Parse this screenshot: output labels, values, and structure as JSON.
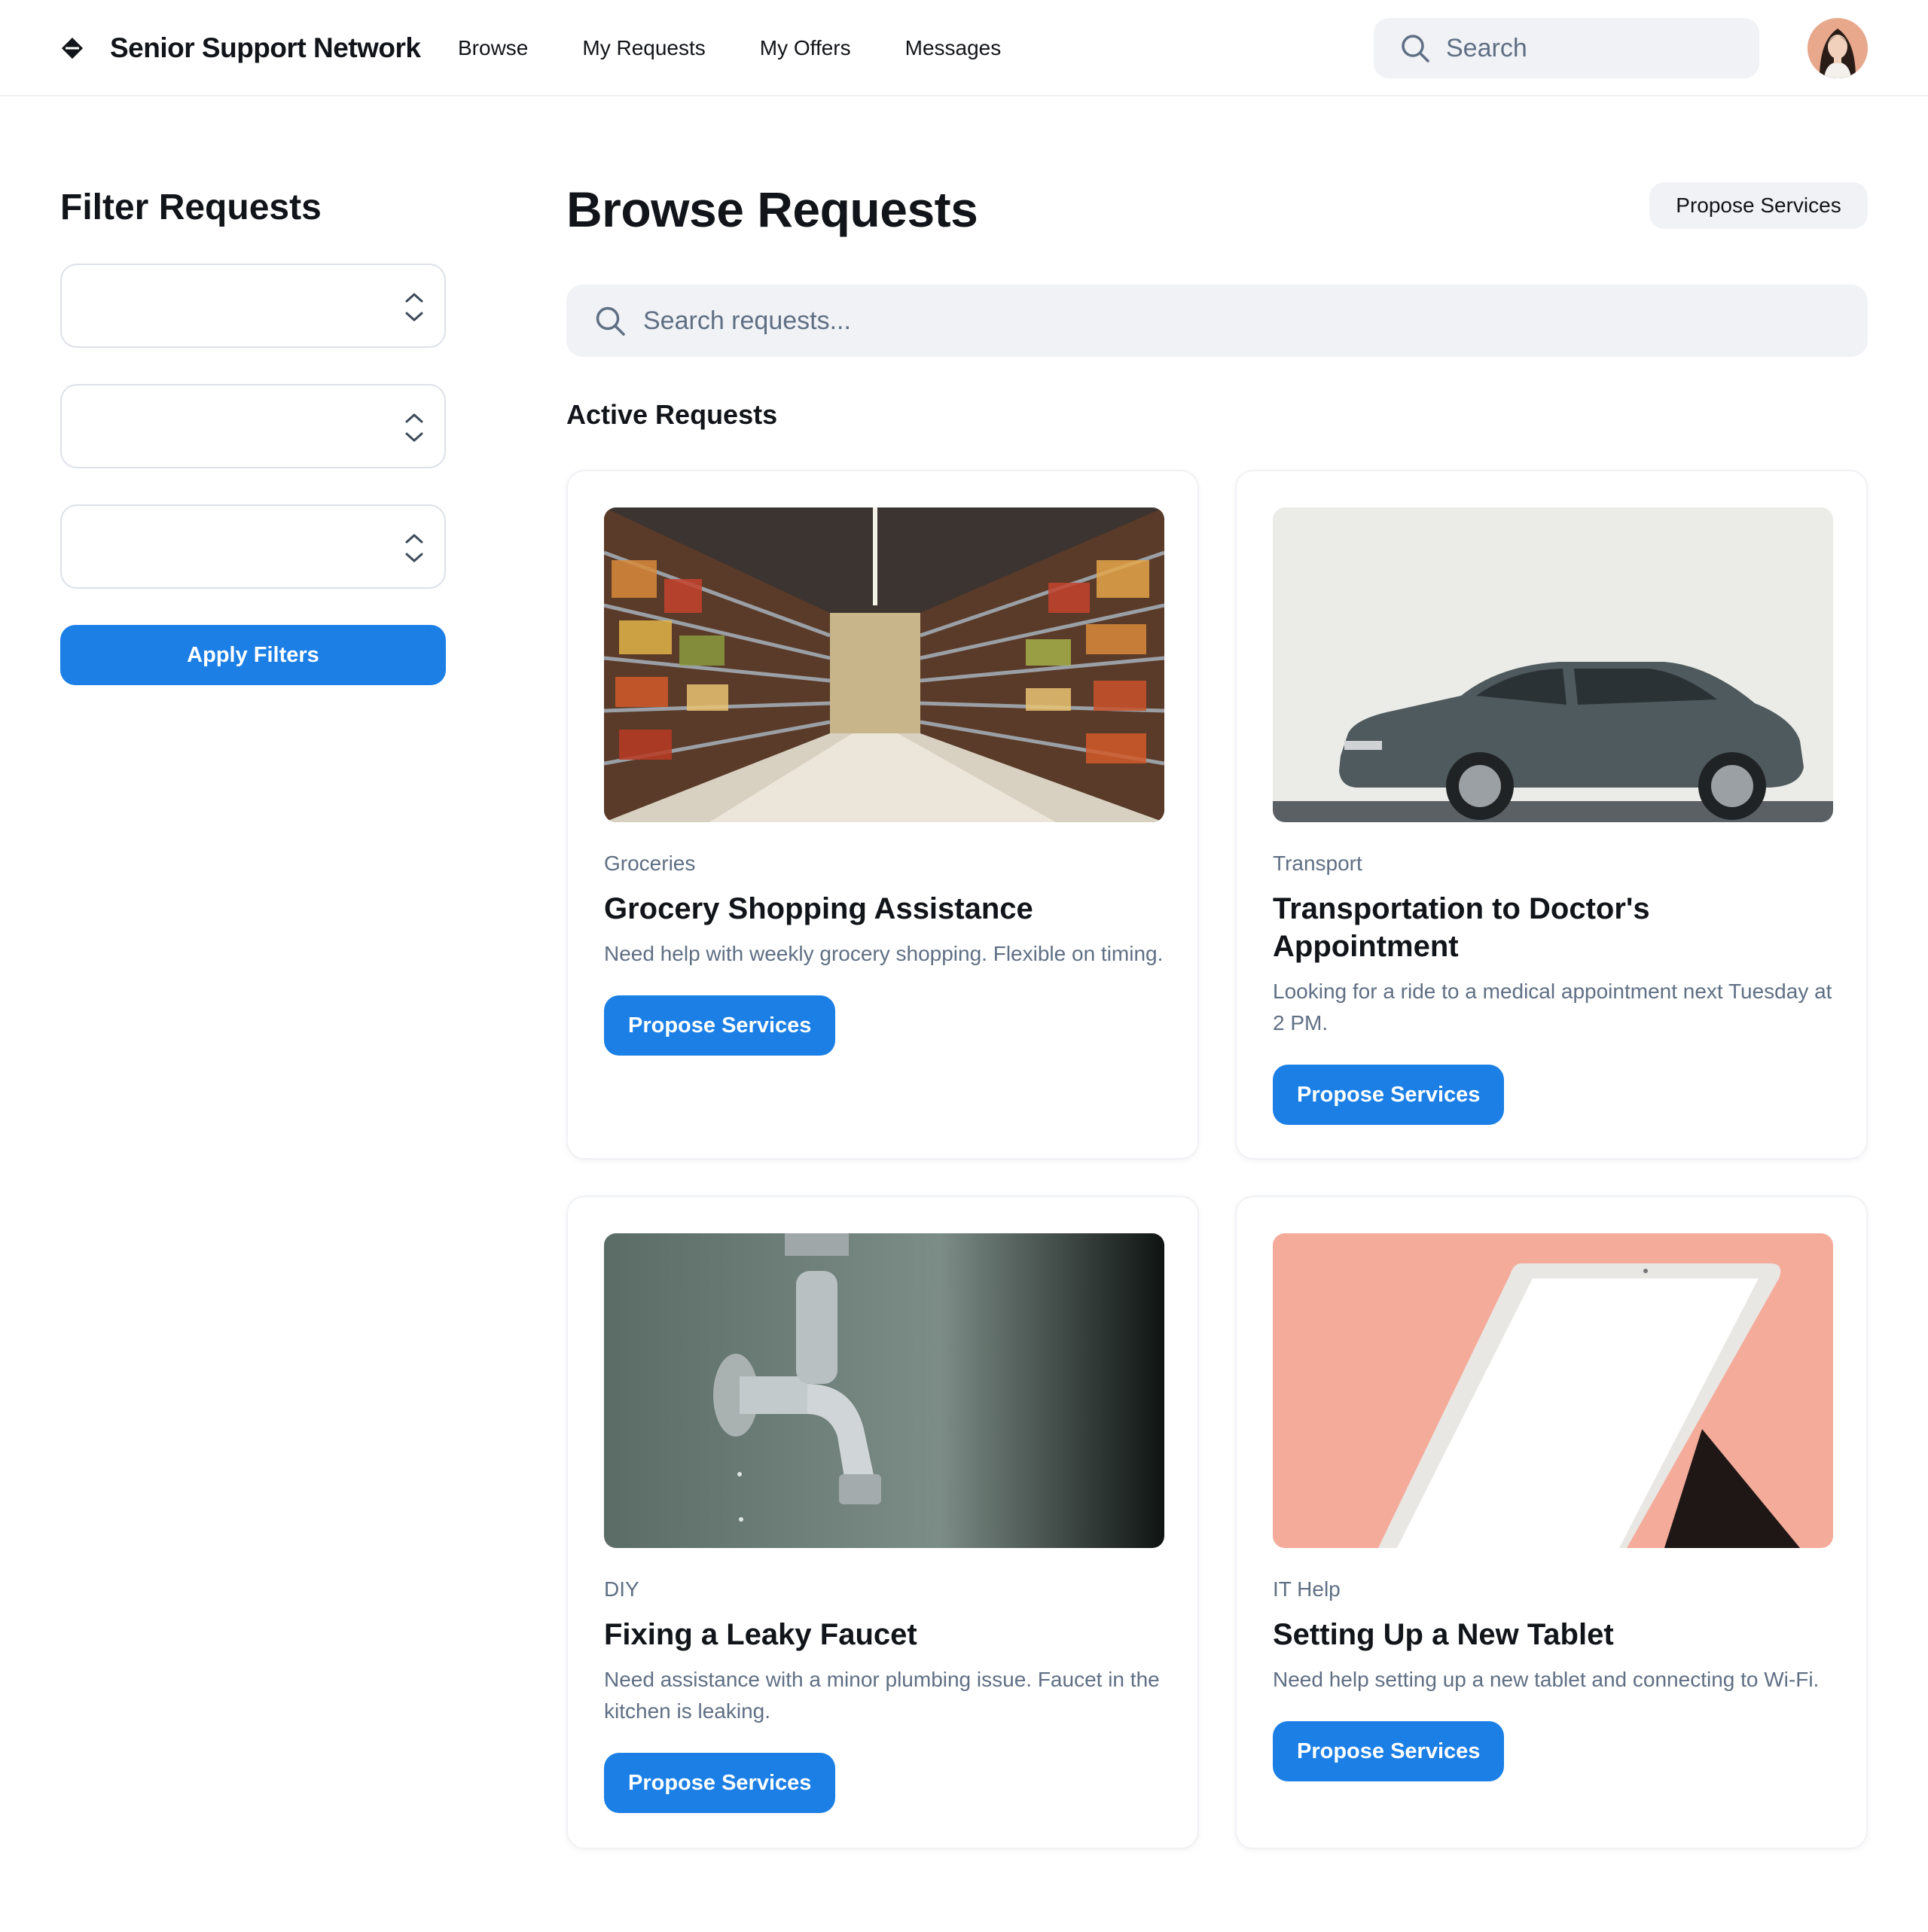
{
  "header": {
    "brand": "Senior Support Network",
    "nav": [
      "Browse",
      "My Requests",
      "My Offers",
      "Messages"
    ],
    "search_placeholder": "Search"
  },
  "sidebar": {
    "title": "Filter Requests",
    "filters": [
      "",
      "",
      ""
    ],
    "apply_label": "Apply Filters"
  },
  "main": {
    "title": "Browse Requests",
    "propose_label": "Propose Services",
    "search_placeholder": "Search requests...",
    "section_title": "Active Requests",
    "cards": [
      {
        "category": "Groceries",
        "title": "Grocery Shopping Assistance",
        "description": "Need help with weekly grocery shopping. Flexible on timing.",
        "button": "Propose Services"
      },
      {
        "category": "Transport",
        "title": "Transportation to Doctor's Appointment",
        "description": "Looking for a ride to a medical appointment next Tuesday at 2 PM.",
        "button": "Propose Services"
      },
      {
        "category": "DIY",
        "title": "Fixing a Leaky Faucet",
        "description": "Need assistance with a minor plumbing issue. Faucet in the kitchen is leaking.",
        "button": "Propose Services"
      },
      {
        "category": "IT Help",
        "title": "Setting Up a New Tablet",
        "description": "Need help setting up a new tablet and connecting to Wi-Fi.",
        "button": "Propose Services"
      }
    ]
  },
  "colors": {
    "primary": "#1b7fe6",
    "text": "#111418",
    "muted": "#5f6f84",
    "surface": "#f0f2f5"
  }
}
